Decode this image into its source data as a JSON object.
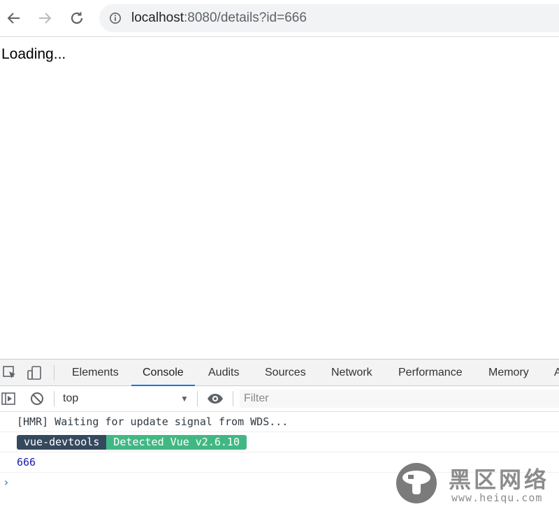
{
  "browser": {
    "url_host": "localhost",
    "url_rest": ":8080/details?id=666"
  },
  "page": {
    "text": "Loading..."
  },
  "devtools": {
    "tabs": [
      "Elements",
      "Console",
      "Audits",
      "Sources",
      "Network",
      "Performance",
      "Memory",
      "A"
    ],
    "active_tab": "Console",
    "context": "top",
    "filter_placeholder": "Filter",
    "messages": {
      "hmr": "[HMR] Waiting for update signal from WDS...",
      "badge_left": "vue-devtools",
      "badge_right": "Detected Vue v2.6.10",
      "value": "666"
    },
    "prompt": "›"
  },
  "watermark": {
    "title": "黑区网络",
    "url": "www.heiqu.com"
  },
  "colors": {
    "accent": "#1a73e8",
    "vue_dark": "#35495e",
    "vue_green": "#41b883",
    "number_blue": "#1a1aa6"
  }
}
